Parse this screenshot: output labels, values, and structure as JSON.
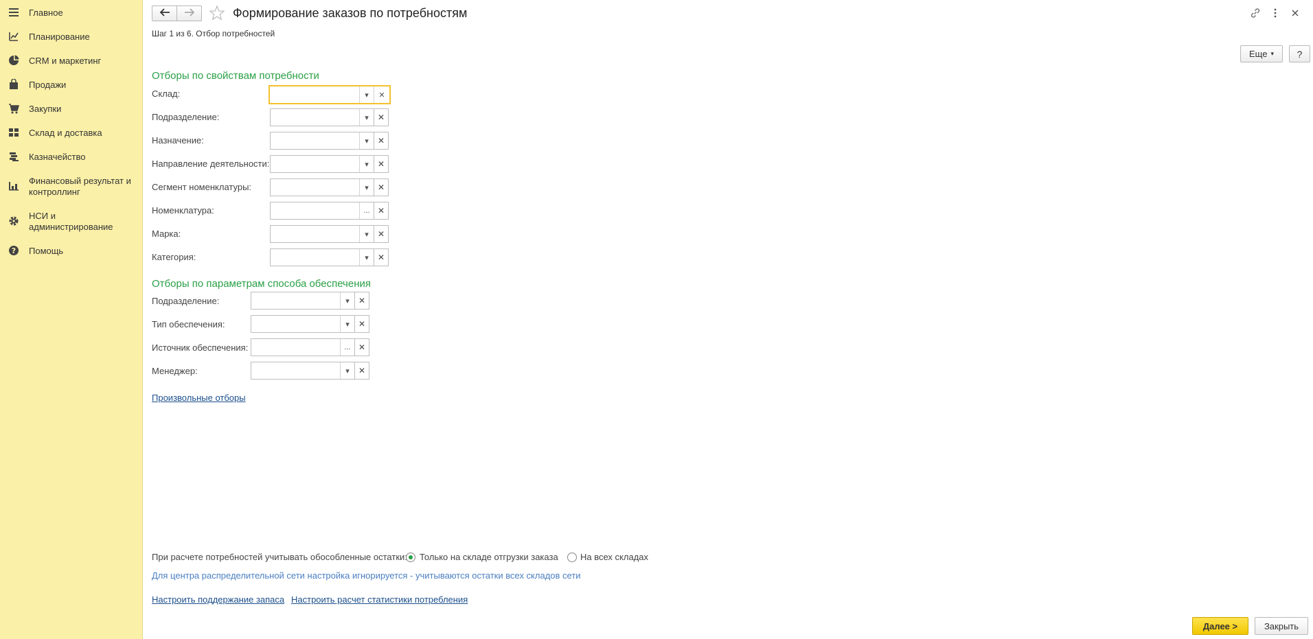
{
  "sidebar": {
    "items": [
      {
        "label": "Главное",
        "icon": "menu-icon"
      },
      {
        "label": "Планирование",
        "icon": "planning-icon"
      },
      {
        "label": "CRM и маркетинг",
        "icon": "pie-chart-icon"
      },
      {
        "label": "Продажи",
        "icon": "bag-icon"
      },
      {
        "label": "Закупки",
        "icon": "cart-icon"
      },
      {
        "label": "Склад и доставка",
        "icon": "warehouse-icon"
      },
      {
        "label": "Казначейство",
        "icon": "coins-icon"
      },
      {
        "label": "Финансовый результат и контроллинг",
        "icon": "bar-chart-icon"
      },
      {
        "label": "НСИ и администрирование",
        "icon": "gear-icon"
      },
      {
        "label": "Помощь",
        "icon": "help-icon"
      }
    ]
  },
  "header": {
    "title": "Формирование заказов по потребностям",
    "step": "Шаг 1 из 6. Отбор потребностей"
  },
  "toolbar": {
    "more_label": "Еще",
    "help_label": "?"
  },
  "section1": {
    "title": "Отборы по свойствам потребности",
    "fields": [
      {
        "label": "Склад:",
        "value": "",
        "button": "▾"
      },
      {
        "label": "Подразделение:",
        "value": "",
        "button": "▾"
      },
      {
        "label": "Назначение:",
        "value": "",
        "button": "▾"
      },
      {
        "label": "Направление деятельности:",
        "value": "",
        "button": "▾"
      },
      {
        "label": "Сегмент номенклатуры:",
        "value": "",
        "button": "▾"
      },
      {
        "label": "Номенклатура:",
        "value": "",
        "button": "..."
      },
      {
        "label": "Марка:",
        "value": "",
        "button": "▾"
      },
      {
        "label": "Категория:",
        "value": "",
        "button": "▾"
      }
    ]
  },
  "section2": {
    "title": "Отборы по параметрам способа обеспечения",
    "fields": [
      {
        "label": "Подразделение:",
        "value": "",
        "button": "▾"
      },
      {
        "label": "Тип обеспечения:",
        "value": "",
        "button": "▾"
      },
      {
        "label": "Источник обеспечения:",
        "value": "",
        "button": "..."
      },
      {
        "label": "Менеджер:",
        "value": "",
        "button": "▾"
      }
    ]
  },
  "custom_filters_link": "Произвольные отборы",
  "stock_option": {
    "label": "При расчете потребностей учитывать обособленные остатки:",
    "option1": "Только на складе отгрузки заказа",
    "option2": "На всех складах",
    "hint": "Для центра распределительной сети настройка игнорируется - учитываются остатки всех складов сети"
  },
  "links": {
    "stock_support": "Настроить поддержание запаса",
    "stats": "Настроить расчет статистики потребления"
  },
  "footer": {
    "next_label": "Далее >",
    "close_label": "Закрыть"
  },
  "colors": {
    "sidebar_bg": "#fbf0a8",
    "section_title": "#2aa046",
    "primary_button": "#f5d000",
    "focus_border": "#f3c02e"
  }
}
